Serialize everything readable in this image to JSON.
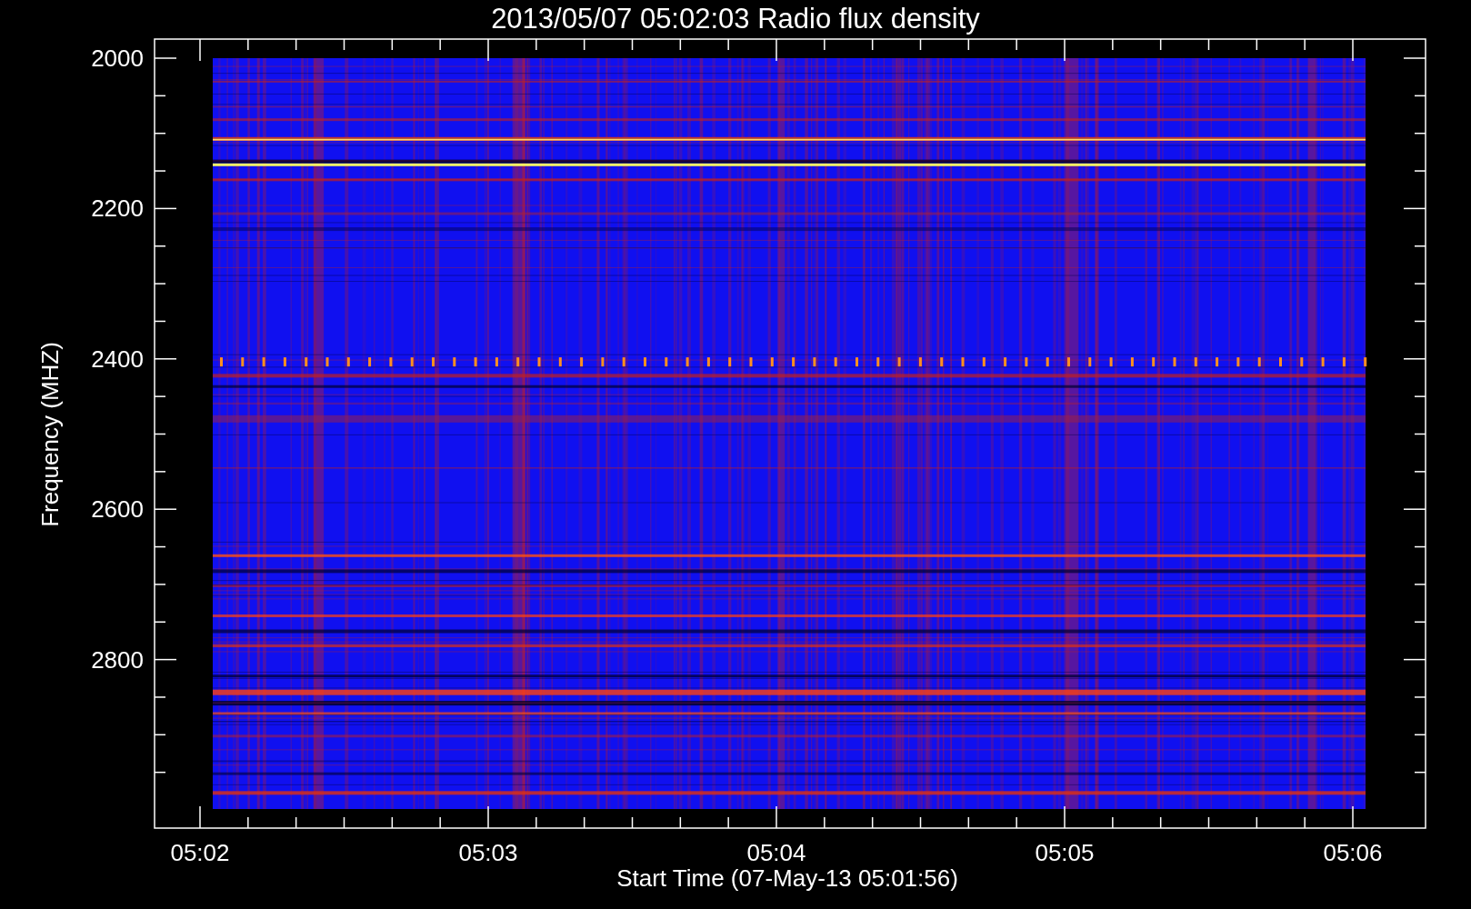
{
  "plot": {
    "title": "2013/05/07 05:02:03 Radio flux density",
    "ylabel": "Frequency (MHZ)",
    "xlabel": "Start Time (07-May-13 05:01:56)",
    "yticks": [
      "2000",
      "2200",
      "2400",
      "2600",
      "2800"
    ],
    "xticks": [
      "05:02",
      "05:03",
      "05:04",
      "05:05",
      "05:06"
    ]
  }
}
